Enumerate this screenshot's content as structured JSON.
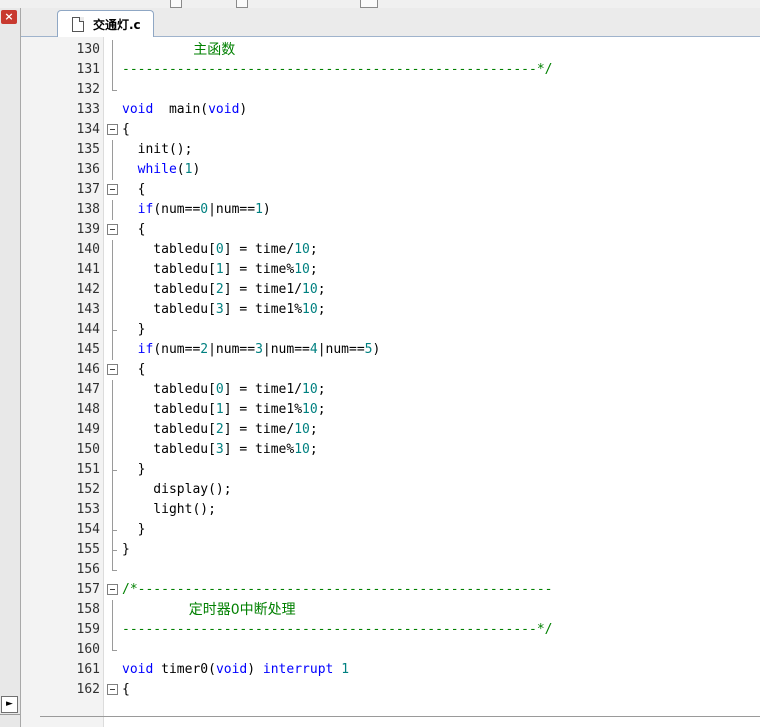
{
  "file_tab": {
    "label": "交通灯.c"
  },
  "sidebar": {
    "close_glyph": "×",
    "arrow_glyph": "►"
  },
  "lines": [
    {
      "n": "130",
      "fold": "line",
      "segs": [
        [
          "cmt-cn",
          "                主函数"
        ]
      ]
    },
    {
      "n": "131",
      "fold": "line",
      "segs": [
        [
          "cmt",
          "-----------------------------------------------------*/"
        ]
      ]
    },
    {
      "n": "132",
      "fold": "end",
      "segs": []
    },
    {
      "n": "133",
      "fold": "",
      "segs": [
        [
          "kw",
          "void"
        ],
        [
          "",
          "  main("
        ],
        [
          "kw",
          "void"
        ],
        [
          "",
          ")"
        ]
      ]
    },
    {
      "n": "134",
      "fold": "box",
      "segs": [
        [
          "",
          "{"
        ]
      ]
    },
    {
      "n": "135",
      "fold": "line",
      "segs": [
        [
          "",
          "  init();"
        ]
      ]
    },
    {
      "n": "136",
      "fold": "line",
      "segs": [
        [
          "kw",
          "  while"
        ],
        [
          "",
          "("
        ],
        [
          "num",
          "1"
        ],
        [
          "",
          ")"
        ]
      ]
    },
    {
      "n": "137",
      "fold": "box",
      "segs": [
        [
          "",
          "  {"
        ]
      ]
    },
    {
      "n": "138",
      "fold": "line",
      "segs": [
        [
          "kw",
          "  if"
        ],
        [
          "",
          "(num=="
        ],
        [
          "num",
          "0"
        ],
        [
          "",
          "|num=="
        ],
        [
          "num",
          "1"
        ],
        [
          "",
          ")"
        ]
      ]
    },
    {
      "n": "139",
      "fold": "box",
      "segs": [
        [
          "",
          "  {"
        ]
      ]
    },
    {
      "n": "140",
      "fold": "line",
      "segs": [
        [
          "",
          "    tabledu["
        ],
        [
          "num",
          "0"
        ],
        [
          "",
          "] = time/"
        ],
        [
          "num",
          "10"
        ],
        [
          "",
          ";"
        ]
      ]
    },
    {
      "n": "141",
      "fold": "line",
      "segs": [
        [
          "",
          "    tabledu["
        ],
        [
          "num",
          "1"
        ],
        [
          "",
          "] = time%"
        ],
        [
          "num",
          "10"
        ],
        [
          "",
          ";"
        ]
      ]
    },
    {
      "n": "142",
      "fold": "line",
      "segs": [
        [
          "",
          "    tabledu["
        ],
        [
          "num",
          "2"
        ],
        [
          "",
          "] = time1/"
        ],
        [
          "num",
          "10"
        ],
        [
          "",
          ";"
        ]
      ]
    },
    {
      "n": "143",
      "fold": "line",
      "segs": [
        [
          "",
          "    tabledu["
        ],
        [
          "num",
          "3"
        ],
        [
          "",
          "] = time1%"
        ],
        [
          "num",
          "10"
        ],
        [
          "",
          ";"
        ]
      ]
    },
    {
      "n": "144",
      "fold": "tick",
      "segs": [
        [
          "",
          "  }"
        ]
      ]
    },
    {
      "n": "145",
      "fold": "line",
      "segs": [
        [
          "kw",
          "  if"
        ],
        [
          "",
          "(num=="
        ],
        [
          "num",
          "2"
        ],
        [
          "",
          "|num=="
        ],
        [
          "num",
          "3"
        ],
        [
          "",
          "|num=="
        ],
        [
          "num",
          "4"
        ],
        [
          "",
          "|num=="
        ],
        [
          "num",
          "5"
        ],
        [
          "",
          ")"
        ]
      ]
    },
    {
      "n": "146",
      "fold": "box",
      "segs": [
        [
          "",
          "  {"
        ]
      ]
    },
    {
      "n": "147",
      "fold": "line",
      "segs": [
        [
          "",
          "    tabledu["
        ],
        [
          "num",
          "0"
        ],
        [
          "",
          "] = time1/"
        ],
        [
          "num",
          "10"
        ],
        [
          "",
          ";"
        ]
      ]
    },
    {
      "n": "148",
      "fold": "line",
      "segs": [
        [
          "",
          "    tabledu["
        ],
        [
          "num",
          "1"
        ],
        [
          "",
          "] = time1%"
        ],
        [
          "num",
          "10"
        ],
        [
          "",
          ";"
        ]
      ]
    },
    {
      "n": "149",
      "fold": "line",
      "segs": [
        [
          "",
          "    tabledu["
        ],
        [
          "num",
          "2"
        ],
        [
          "",
          "] = time/"
        ],
        [
          "num",
          "10"
        ],
        [
          "",
          ";"
        ]
      ]
    },
    {
      "n": "150",
      "fold": "line",
      "segs": [
        [
          "",
          "    tabledu["
        ],
        [
          "num",
          "3"
        ],
        [
          "",
          "] = time%"
        ],
        [
          "num",
          "10"
        ],
        [
          "",
          ";"
        ]
      ]
    },
    {
      "n": "151",
      "fold": "tick",
      "segs": [
        [
          "",
          "  }"
        ]
      ]
    },
    {
      "n": "152",
      "fold": "line",
      "segs": [
        [
          "",
          "    display();"
        ]
      ]
    },
    {
      "n": "153",
      "fold": "line",
      "segs": [
        [
          "",
          "    light();"
        ]
      ]
    },
    {
      "n": "154",
      "fold": "tick",
      "segs": [
        [
          "",
          "  }"
        ]
      ]
    },
    {
      "n": "155",
      "fold": "tick",
      "segs": [
        [
          "",
          "}"
        ]
      ]
    },
    {
      "n": "156",
      "fold": "end",
      "segs": []
    },
    {
      "n": "157",
      "fold": "box",
      "segs": [
        [
          "cmt",
          "/*-----------------------------------------------------"
        ]
      ]
    },
    {
      "n": "158",
      "fold": "line",
      "segs": [
        [
          "cmt-cn",
          "               定时器0中断处理"
        ]
      ]
    },
    {
      "n": "159",
      "fold": "line",
      "segs": [
        [
          "cmt",
          "-----------------------------------------------------*/"
        ]
      ]
    },
    {
      "n": "160",
      "fold": "end",
      "segs": []
    },
    {
      "n": "161",
      "fold": "",
      "segs": [
        [
          "kw",
          "void"
        ],
        [
          "",
          " timer0("
        ],
        [
          "kw",
          "void"
        ],
        [
          "",
          ") "
        ],
        [
          "kw",
          "interrupt"
        ],
        [
          "",
          " "
        ],
        [
          "num",
          "1"
        ]
      ]
    },
    {
      "n": "162",
      "fold": "box",
      "segs": [
        [
          "",
          "{"
        ]
      ]
    }
  ]
}
